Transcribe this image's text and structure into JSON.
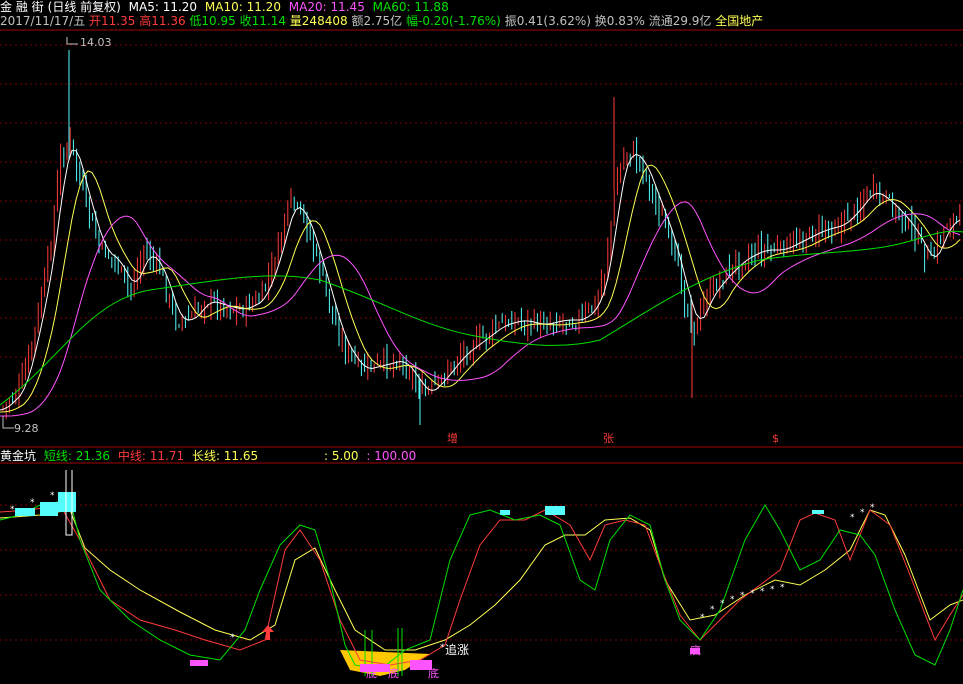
{
  "header": {
    "stock": "金 融 街",
    "mode": "(日线 前复权)",
    "ma5": "MA5: 11.20",
    "ma10": "MA10: 11.20",
    "ma20": "MA20: 11.45",
    "ma60": "MA60: 11.88"
  },
  "info": {
    "date": "2017/11/17/五",
    "open": "开11.35",
    "high": "高11.36",
    "low": "低10.95",
    "close": "收11.14",
    "volume": "量248408",
    "amount": "额2.75亿",
    "change": "幅-0.20(-1.76%)",
    "amplitude": "振0.41(3.62%)",
    "turnover": "换0.83%",
    "float": "流通29.9亿",
    "sector": "全国地产"
  },
  "price_chart": {
    "max_label": "14.03",
    "min_label": "9.28",
    "signals": [
      "增",
      "张",
      "$"
    ]
  },
  "indicator": {
    "name": "黄金坑",
    "short": "短线: 21.36",
    "mid": "中线: 11.71",
    "long": "长线: 11.65",
    "level1": ": 5.00",
    "level2": ": 100.00",
    "rise_label": "追涨",
    "bottom_labels": [
      "底",
      "底",
      "底",
      "底"
    ]
  },
  "colors": {
    "up": "#ff3b3b",
    "down": "#54fcfc",
    "ma5": "#ffffff",
    "ma10": "#ffff54",
    "ma20": "#ff54ff",
    "ma60": "#00e000",
    "grid": "#7a0000",
    "gold": "#ffc800"
  }
}
